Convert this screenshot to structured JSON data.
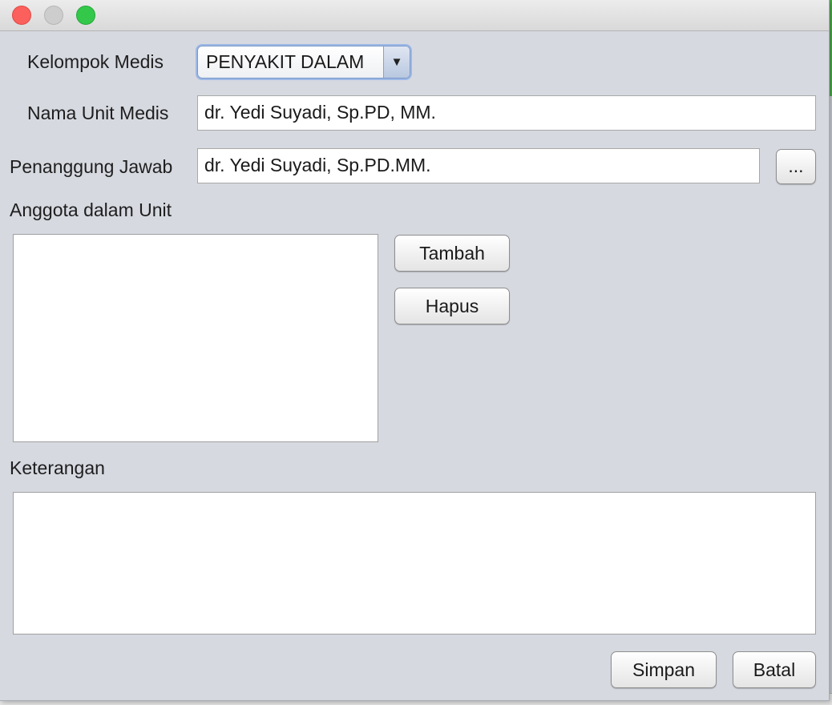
{
  "form": {
    "kelompok_medis_label": "Kelompok Medis",
    "kelompok_medis_value": "PENYAKIT DALAM",
    "nama_unit_label": "Nama Unit Medis",
    "nama_unit_value": "dr. Yedi Suyadi, Sp.PD, MM.",
    "penanggung_jawab_label": "Penanggung Jawab",
    "penanggung_jawab_value": "dr. Yedi Suyadi, Sp.PD.MM.",
    "browse_label": "...",
    "anggota_label": "Anggota dalam Unit",
    "anggota_items": [],
    "tambah_label": "Tambah",
    "hapus_label": "Hapus",
    "keterangan_label": "Keterangan",
    "keterangan_value": "",
    "simpan_label": "Simpan",
    "batal_label": "Batal"
  },
  "icons": {
    "dropdown": "triangle-down-icon",
    "close": "close-icon",
    "minimize": "minimize-icon",
    "maximize": "maximize-icon"
  },
  "colors": {
    "window_bg": "#d6d9e0",
    "close": "#fc605c",
    "minimize": "#cdcdcd",
    "maximize": "#34c84a",
    "focus_ring": "#9cb8e6"
  }
}
